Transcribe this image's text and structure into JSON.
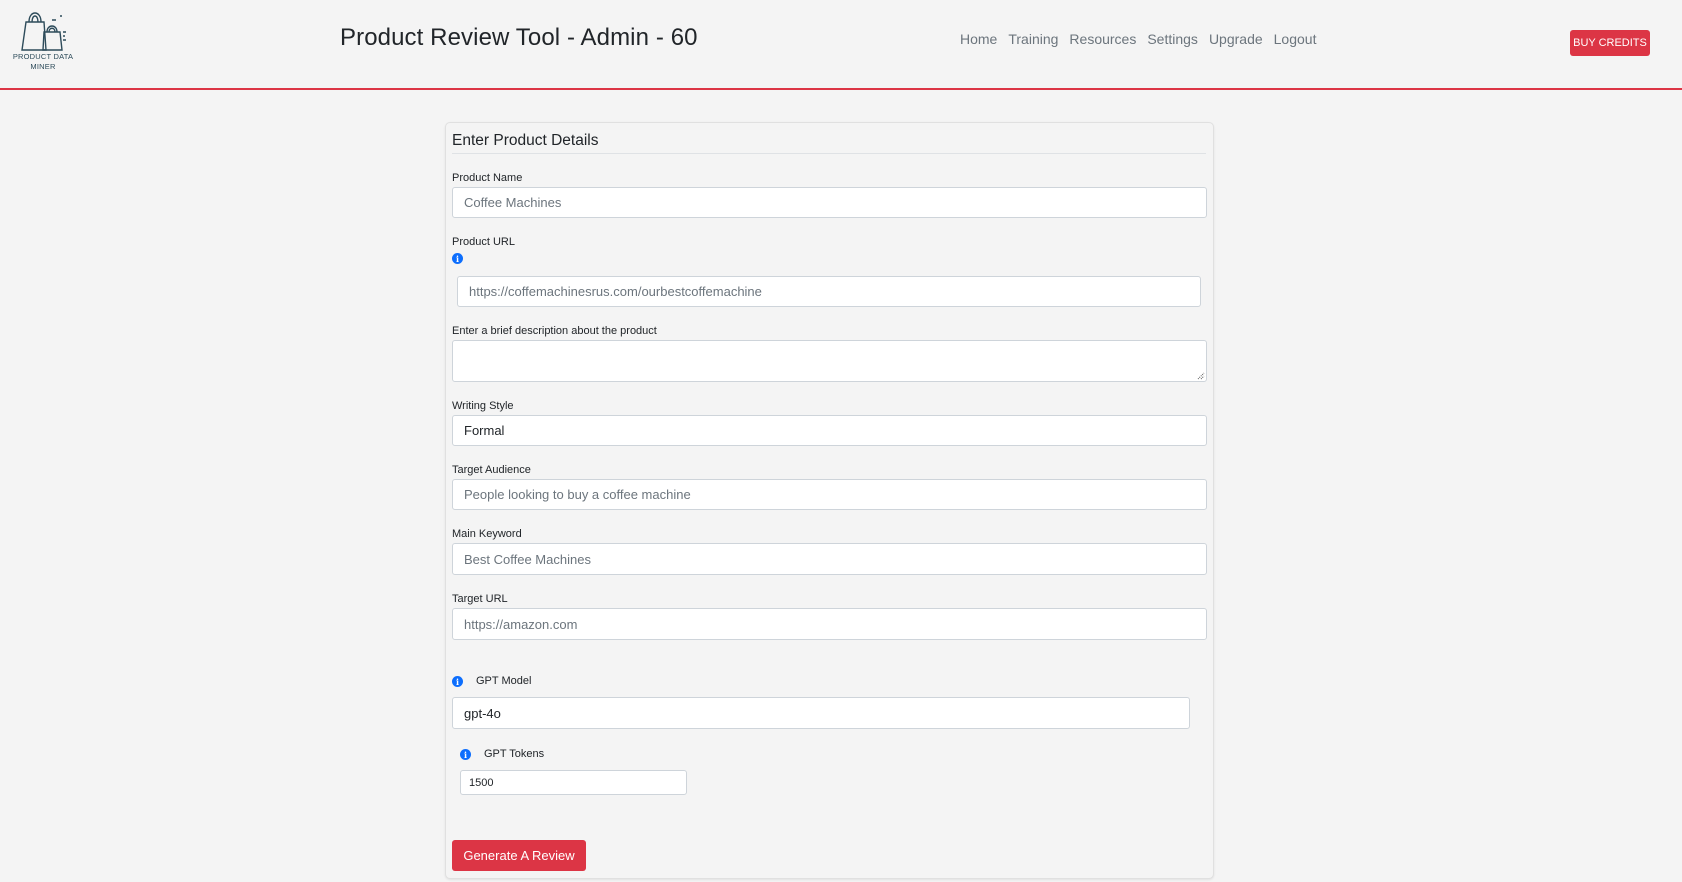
{
  "header": {
    "logo_text_line1": "PRODUCT DATA",
    "logo_text_line2": "MINER",
    "title": "Product Review Tool - Admin - 60",
    "nav": [
      {
        "label": "Home"
      },
      {
        "label": "Training"
      },
      {
        "label": "Resources"
      },
      {
        "label": "Settings"
      },
      {
        "label": "Upgrade"
      },
      {
        "label": "Logout"
      }
    ],
    "buy_credits_label": "BUY CREDITS",
    "accent_color": "#dc3545"
  },
  "form": {
    "title": "Enter Product Details",
    "product_name": {
      "label": "Product Name",
      "value": "Coffee Machines"
    },
    "product_url": {
      "label": "Product URL",
      "info_icon": "info-circle-icon",
      "value": "https://coffemachinesrus.com/ourbestcoffemachine"
    },
    "description": {
      "label": "Enter a brief description about the product",
      "value": ""
    },
    "writing_style": {
      "label": "Writing Style",
      "value": "Formal"
    },
    "target_audience": {
      "label": "Target Audience",
      "value": "People looking to buy a coffee machine"
    },
    "main_keyword": {
      "label": "Main Keyword",
      "value": "Best Coffee Machines"
    },
    "target_url": {
      "label": "Target URL",
      "value": "https://amazon.com"
    },
    "gpt_model": {
      "label": "GPT Model",
      "info_icon": "info-circle-icon",
      "value": "gpt-4o"
    },
    "gpt_tokens": {
      "label": "GPT Tokens",
      "info_icon": "info-circle-icon",
      "value": "1500"
    },
    "submit_label": "Generate A Review"
  }
}
